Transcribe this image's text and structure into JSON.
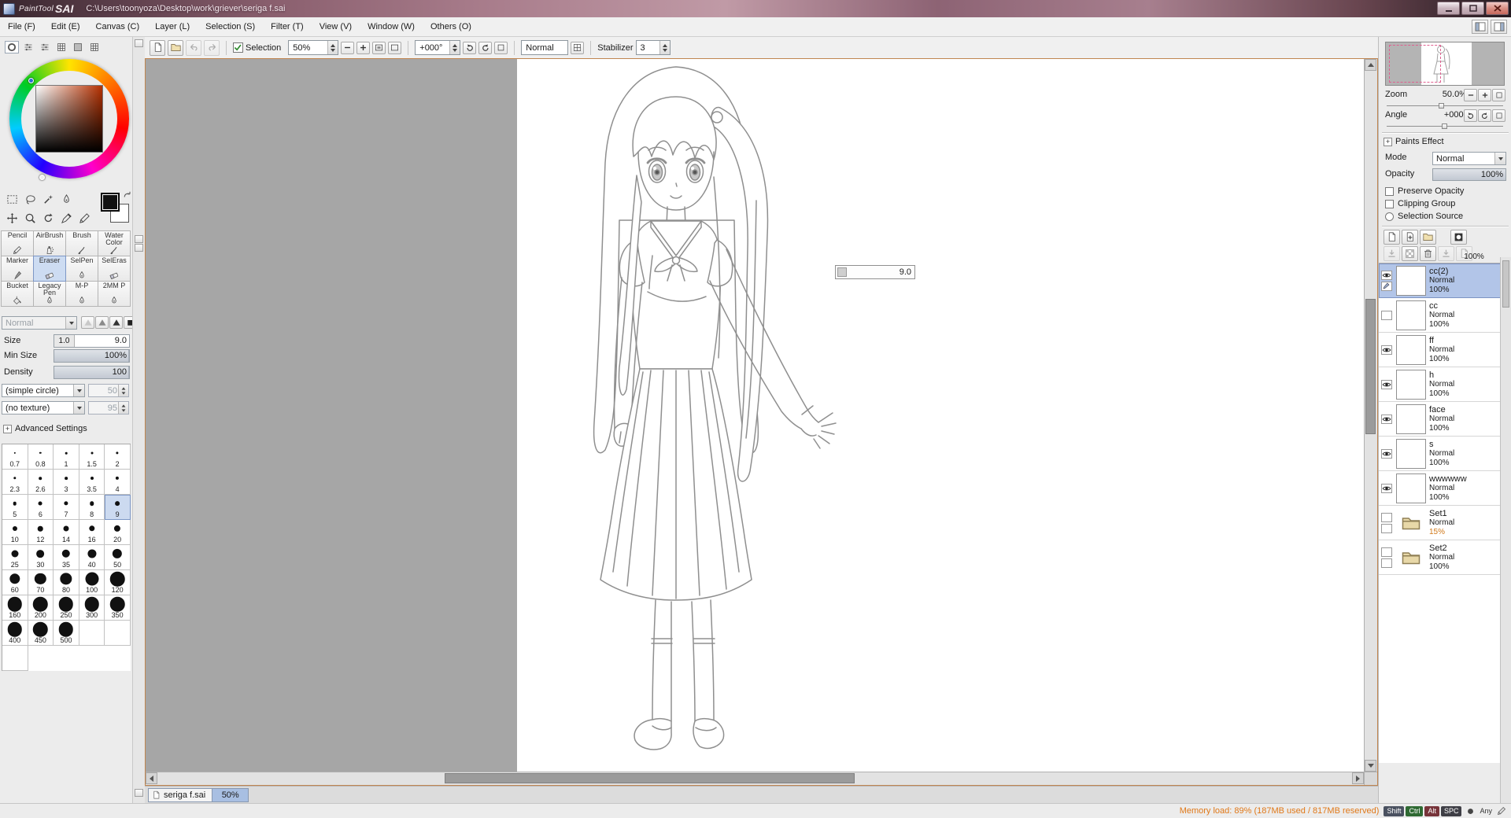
{
  "titlebar": {
    "brand_light": "PaintTool",
    "brand_bold": "SAI",
    "file_path": "C:\\Users\\toonyoza\\Desktop\\work\\griever\\seriga f.sai"
  },
  "menubar": {
    "items": [
      "File (F)",
      "Edit (E)",
      "Canvas (C)",
      "Layer (L)",
      "Selection (S)",
      "Filter (T)",
      "View (V)",
      "Window (W)",
      "Others (O)"
    ]
  },
  "toolbar": {
    "selection_label": "Selection",
    "zoom_value": "50%",
    "angle_value": "+000°",
    "blend_value": "Normal",
    "stabilizer_label": "Stabilizer",
    "stabilizer_value": "3"
  },
  "left_panel": {
    "color_tabs": [
      "color-wheel",
      "rgb-sliders",
      "hsv-sliders",
      "color-swatches",
      "scratchpad",
      "color-mixer"
    ],
    "tools": [
      "rect-select",
      "lasso",
      "magic-wand",
      "pen",
      "move",
      "zoom",
      "rotate-canvas",
      "eyedropper",
      "pencil"
    ],
    "tool_grid": {
      "items": [
        "Pencil",
        "AirBrush",
        "Brush",
        "Water Color",
        "Marker",
        "Eraser",
        "SelPen",
        "SelEras",
        "Bucket",
        "Legacy Pen",
        "M-P",
        "2MM P"
      ],
      "selected": "Eraser"
    },
    "blend_mode": "Normal",
    "size": {
      "label": "Size",
      "unit": "1.0",
      "value": "9.0"
    },
    "min_size": {
      "label": "Min Size",
      "value": "100%"
    },
    "density": {
      "label": "Density",
      "value": "100"
    },
    "shape": {
      "label": "(simple circle)",
      "value": "50"
    },
    "texture": {
      "label": "(no texture)",
      "value": "95"
    },
    "advanced_label": "Advanced Settings",
    "brush_sizes": {
      "values": [
        0.7,
        0.8,
        1,
        1.5,
        2,
        2.3,
        2.6,
        3,
        3.5,
        4,
        5,
        6,
        7,
        8,
        9,
        10,
        12,
        14,
        16,
        20,
        25,
        30,
        35,
        40,
        50,
        60,
        70,
        80,
        100,
        120,
        160,
        200,
        250,
        300,
        350,
        400,
        450,
        500
      ],
      "selected": 9
    }
  },
  "canvas": {
    "size_tooltip": "9.0",
    "tab": {
      "title": "seriga f.sai",
      "zoom": "50%"
    }
  },
  "navigator": {
    "zoom_label": "Zoom",
    "zoom_value": "50.0%",
    "angle_label": "Angle",
    "angle_value": "+000°"
  },
  "layer_panel": {
    "section_title": "Paints Effect",
    "mode_label": "Mode",
    "mode_value": "Normal",
    "opacity_label": "Opacity",
    "opacity_value": "100%",
    "preserve_opacity_label": "Preserve Opacity",
    "clipping_group_label": "Clipping Group",
    "selection_source_label": "Selection Source",
    "stack_opacity": "100%",
    "ops_row1": [
      "new-layer",
      "duplicate-layer",
      "new-folder",
      "layer-mask"
    ],
    "ops_row2": [
      "transfer-down",
      "clear-layer",
      "delete-layer"
    ],
    "layers": [
      {
        "name": "cc(2)",
        "mode": "Normal",
        "opacity": "100%",
        "type": "layer",
        "visible": true,
        "selected": true,
        "painting": true
      },
      {
        "name": "cc",
        "mode": "Normal",
        "opacity": "100%",
        "type": "layer",
        "visible": false,
        "selected": false
      },
      {
        "name": "ff",
        "mode": "Normal",
        "opacity": "100%",
        "type": "layer",
        "visible": true,
        "selected": false
      },
      {
        "name": "h",
        "mode": "Normal",
        "opacity": "100%",
        "type": "layer",
        "visible": true,
        "selected": false
      },
      {
        "name": "face",
        "mode": "Normal",
        "opacity": "100%",
        "type": "layer",
        "visible": true,
        "selected": false
      },
      {
        "name": "s",
        "mode": "Normal",
        "opacity": "100%",
        "type": "layer",
        "visible": true,
        "selected": false
      },
      {
        "name": "wwwwww",
        "mode": "Normal",
        "opacity": "100%",
        "type": "layer",
        "visible": true,
        "selected": false
      },
      {
        "name": "Set1",
        "mode": "Normal",
        "opacity": "15%",
        "type": "folder",
        "visible": false,
        "selected": false,
        "opacity_highlight": true
      },
      {
        "name": "Set2",
        "mode": "Normal",
        "opacity": "100%",
        "type": "folder",
        "visible": false,
        "selected": false
      }
    ]
  },
  "statusbar": {
    "memory_text": "Memory load: 89% (187MB used / 817MB reserved)",
    "keys": [
      "Shift",
      "Ctrl",
      "Alt",
      "SPC"
    ],
    "extra": "Any"
  },
  "colors": {
    "selection_highlight": "#b2c5e8",
    "memory_text": "#e07818",
    "canvas_border": "#c08550",
    "set1_opacity_text": "#d07818"
  }
}
